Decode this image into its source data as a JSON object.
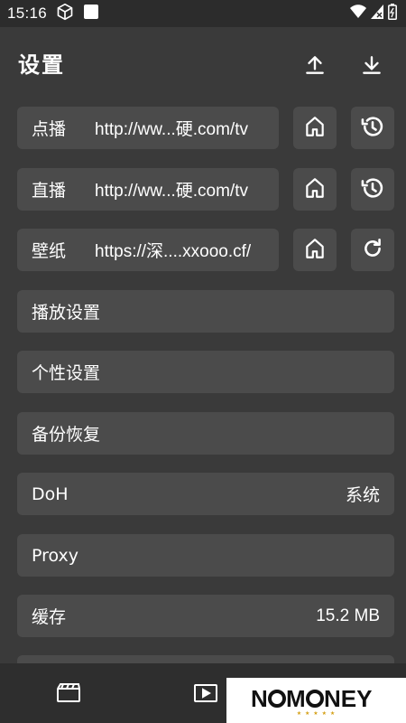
{
  "status_bar": {
    "time": "15:16",
    "icons": [
      "cube-icon",
      "square-icon",
      "wifi-icon",
      "signal-icon",
      "battery-icon"
    ]
  },
  "header": {
    "title": "设置",
    "buttons": [
      "upload-icon",
      "download-icon"
    ]
  },
  "url_rows": [
    {
      "label": "点播",
      "value": "http://ww...硬.com/tv",
      "actions": [
        "home-icon",
        "history-icon"
      ]
    },
    {
      "label": "直播",
      "value": "http://ww...硬.com/tv",
      "actions": [
        "home-icon",
        "history-icon"
      ]
    },
    {
      "label": "壁纸",
      "value": "https://深....xxooo.cf/",
      "actions": [
        "home-icon",
        "refresh-icon"
      ]
    }
  ],
  "settings_items": [
    {
      "label": "播放设置",
      "value": ""
    },
    {
      "label": "个性设置",
      "value": ""
    },
    {
      "label": "备份恢复",
      "value": ""
    },
    {
      "label": "DoH",
      "value": "系统"
    },
    {
      "label": "Proxy",
      "value": ""
    },
    {
      "label": "缓存",
      "value": "15.2 MB"
    }
  ],
  "bottom_nav": {
    "items": [
      "film-icon",
      "play-icon"
    ]
  },
  "watermark": {
    "text": "NOMONEY"
  },
  "colors": {
    "background": "#3a3a3a",
    "card": "#4b4b4b",
    "status_bar": "#2c2c2c",
    "bottom_nav": "#2e2e2e",
    "text": "#ffffff"
  }
}
